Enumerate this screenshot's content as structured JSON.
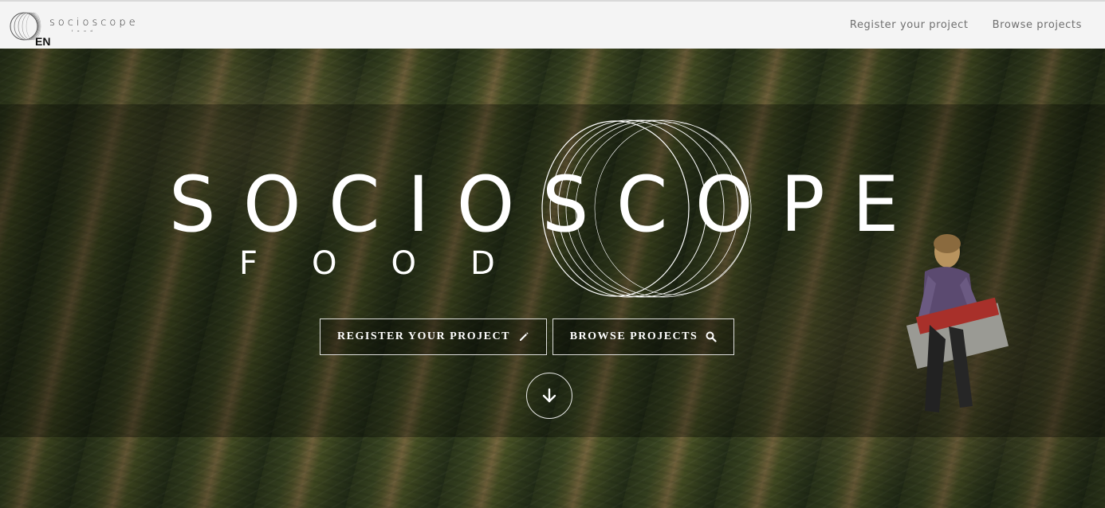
{
  "header": {
    "logo_text": "socioscope",
    "logo_sub": "food",
    "language": "EN",
    "nav": [
      {
        "label": "Register your project"
      },
      {
        "label": "Browse projects"
      }
    ]
  },
  "hero": {
    "logo_text": "SOCIOSCOPE",
    "logo_sub": "FOOD",
    "buttons": {
      "register_label": "REGISTER YOUR PROJECT",
      "register_icon": "pencil-icon",
      "browse_label": "BROWSE PROJECTS",
      "browse_icon": "search-icon"
    },
    "scroll_icon": "arrow-down-icon"
  },
  "colors": {
    "header_bg": "#f4f4f4",
    "nav_text": "#6f6f6f",
    "hero_text": "#ffffff"
  }
}
